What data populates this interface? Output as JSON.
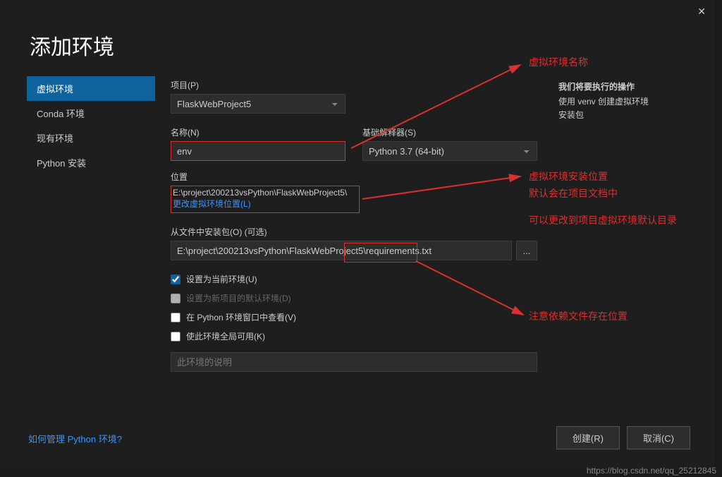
{
  "dialog": {
    "title": "添加环境",
    "close": "✕"
  },
  "sidebar": {
    "items": [
      {
        "label": "虚拟环境",
        "active": true
      },
      {
        "label": "Conda 环境",
        "active": false
      },
      {
        "label": "现有环境",
        "active": false
      },
      {
        "label": "Python 安装",
        "active": false
      }
    ]
  },
  "form": {
    "project_label": "项目(P)",
    "project_value": "FlaskWebProject5",
    "name_label": "名称(N)",
    "name_value": "env",
    "interpreter_label": "基础解释器(S)",
    "interpreter_value": "Python 3.7 (64-bit)",
    "location_label": "位置",
    "location_path": "E:\\project\\200213vsPython\\FlaskWebProject5\\",
    "change_location": "更改虚拟环境位置(L)",
    "packages_label": "从文件中安装包(O) (可选)",
    "packages_value": "E:\\project\\200213vsPython\\FlaskWebProject5\\requirements.txt",
    "browse": "...",
    "check_current": "设置为当前环境(U)",
    "check_default": "设置为新项目的默认环境(D)",
    "check_window": "在 Python 环境窗口中查看(V)",
    "check_global": "使此环境全局可用(K)",
    "desc_placeholder": "此环境的说明"
  },
  "right": {
    "header": "我们将要执行的操作",
    "line1": "使用 venv 创建虚拟环境",
    "line2": "安装包"
  },
  "annotations": {
    "a1": "虚拟环境名称",
    "a2": "虚拟环境安装位置",
    "a3": "默认会在项目文档中",
    "a4": "可以更改到项目虚拟环境默认目录",
    "a5": "注意依赖文件存在位置"
  },
  "footer": {
    "help": "如何管理 Python 环境?",
    "create": "创建(R)",
    "cancel": "取消(C)"
  },
  "watermark": "https://blog.csdn.net/qq_25212845"
}
